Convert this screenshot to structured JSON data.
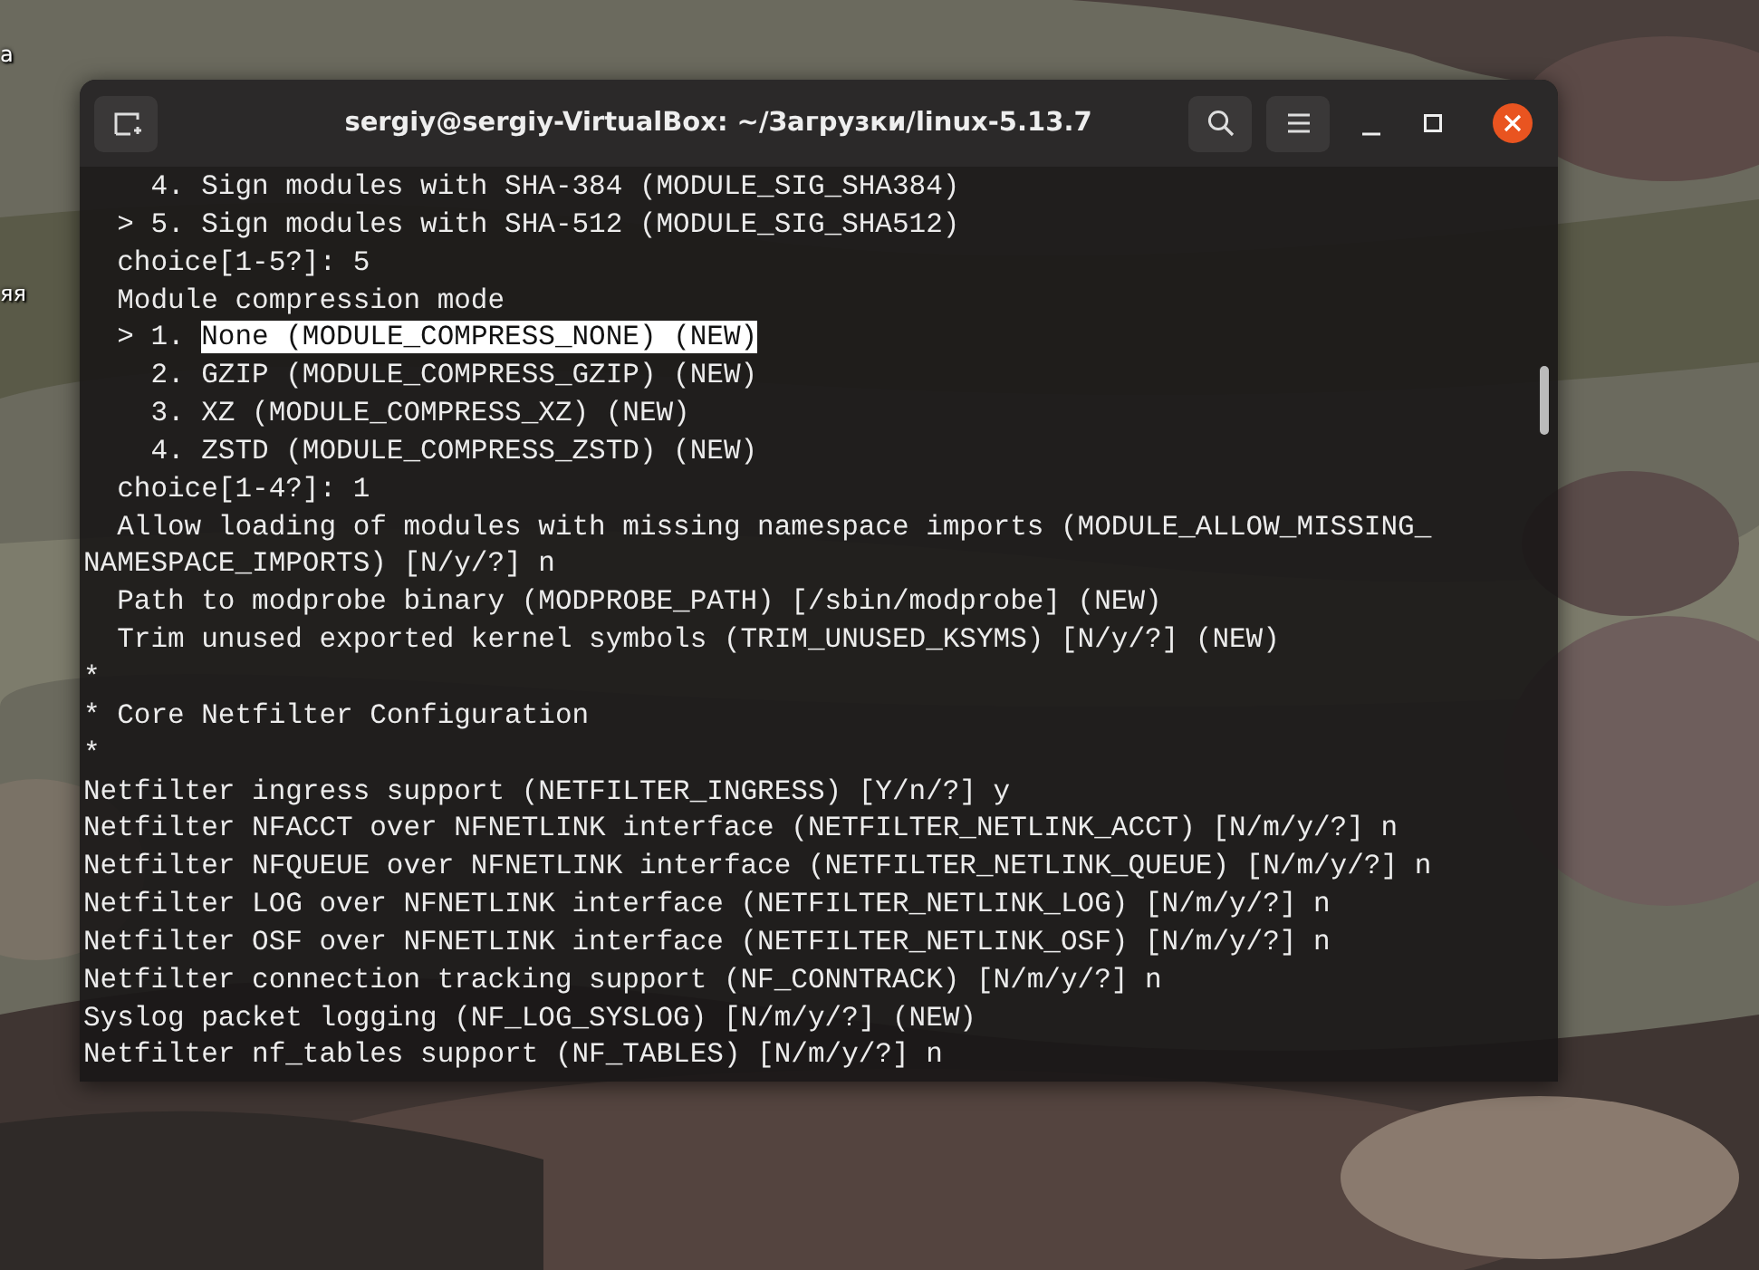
{
  "desktop": {
    "icon_labels": [
      "а",
      "яя"
    ]
  },
  "window": {
    "title": "sergiy@sergiy-VirtualBox: ~/Загрузки/linux-5.13.7"
  },
  "terminal": {
    "lines": [
      {
        "text": "    4. Sign modules with SHA-384 (MODULE_SIG_SHA384)"
      },
      {
        "text": "  > 5. Sign modules with SHA-512 (MODULE_SIG_SHA512)"
      },
      {
        "text": "  choice[1-5?]: 5"
      },
      {
        "text": "  Module compression mode"
      },
      {
        "text": "  > 1. ",
        "highlight": "None (MODULE_COMPRESS_NONE) (NEW)"
      },
      {
        "text": "    2. GZIP (MODULE_COMPRESS_GZIP) (NEW)"
      },
      {
        "text": "    3. XZ (MODULE_COMPRESS_XZ) (NEW)"
      },
      {
        "text": "    4. ZSTD (MODULE_COMPRESS_ZSTD) (NEW)"
      },
      {
        "text": "  choice[1-4?]: 1"
      },
      {
        "text": "  Allow loading of modules with missing namespace imports (MODULE_ALLOW_MISSING_"
      },
      {
        "text": "NAMESPACE_IMPORTS) [N/y/?] n"
      },
      {
        "text": "  Path to modprobe binary (MODPROBE_PATH) [/sbin/modprobe] (NEW)"
      },
      {
        "text": "  Trim unused exported kernel symbols (TRIM_UNUSED_KSYMS) [N/y/?] (NEW)"
      },
      {
        "text": "*"
      },
      {
        "text": "* Core Netfilter Configuration"
      },
      {
        "text": "*"
      },
      {
        "text": "Netfilter ingress support (NETFILTER_INGRESS) [Y/n/?] y"
      },
      {
        "text": "Netfilter NFACCT over NFNETLINK interface (NETFILTER_NETLINK_ACCT) [N/m/y/?] n"
      },
      {
        "text": "Netfilter NFQUEUE over NFNETLINK interface (NETFILTER_NETLINK_QUEUE) [N/m/y/?] n"
      },
      {
        "text": "Netfilter LOG over NFNETLINK interface (NETFILTER_NETLINK_LOG) [N/m/y/?] n"
      },
      {
        "text": "Netfilter OSF over NFNETLINK interface (NETFILTER_NETLINK_OSF) [N/m/y/?] n"
      },
      {
        "text": "Netfilter connection tracking support (NF_CONNTRACK) [N/m/y/?] n"
      },
      {
        "text": "Syslog packet logging (NF_LOG_SYSLOG) [N/m/y/?] (NEW)"
      },
      {
        "text": "Netfilter nf_tables support (NF_TABLES) [N/m/y/?] n"
      }
    ]
  }
}
